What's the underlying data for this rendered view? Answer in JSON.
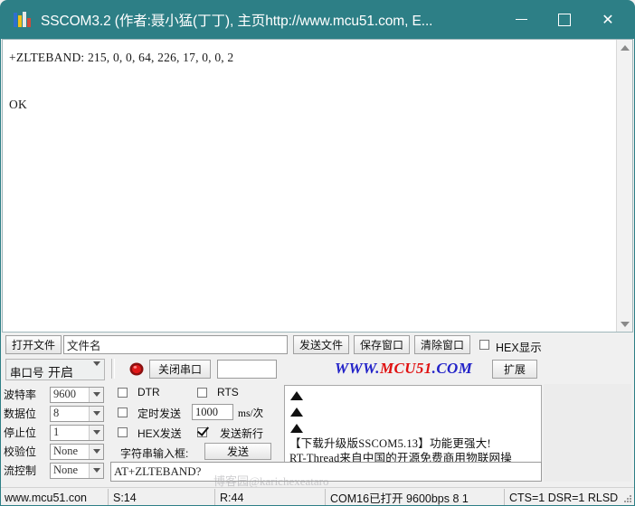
{
  "window": {
    "title": "SSCOM3.2 (作者:聂小猛(丁丁), 主页http://www.mcu51.com, E...",
    "icon": "sscom-app-icon",
    "minimize_label": "minimize-icon",
    "maximize_label": "maximize-icon",
    "close_label": "✕",
    "titlebar_color": "#2d7f86"
  },
  "receive": {
    "content": "+ZLTEBAND: 215, 0, 0, 64, 226, 17, 0, 0, 2\n\nOK",
    "scroll_up": "scroll-up-arrow",
    "scroll_down": "scroll-down-arrow"
  },
  "file_toolbar": {
    "open_file": "打开文件",
    "filename_value": "文件名",
    "send_file": "发送文件",
    "save_window": "保存窗口",
    "clear_window": "清除窗口",
    "hex_show_label": "HEX显示",
    "hex_show_checked": false
  },
  "port_toolbar": {
    "port_label": "串口号",
    "port_value": "开启",
    "led": "red-led-indicator",
    "close_port": "关闭串口",
    "extra_field_value": "",
    "brand_part1": "WWW.",
    "brand_part2": "MCU51",
    "brand_part3": ".COM",
    "brand_color1": "#2222c8",
    "brand_color2": "#e01010",
    "expand": "扩展"
  },
  "serial_params": [
    {
      "label": "波特率",
      "value": "9600"
    },
    {
      "label": "数据位",
      "value": "8"
    },
    {
      "label": "停止位",
      "value": "1"
    },
    {
      "label": "校验位",
      "value": "None"
    },
    {
      "label": "流控制",
      "value": "None"
    }
  ],
  "controls": {
    "dtr_label": "DTR",
    "dtr_checked": false,
    "rts_label": "RTS",
    "rts_checked": false,
    "timer_label": "定时发送",
    "timer_checked": false,
    "timer_value": "1000",
    "timer_unit": "ms/次",
    "hex_send_label": "HEX发送",
    "hex_send_checked": false,
    "newline_label": "发送新行",
    "newline_checked": true,
    "string_input_label": "字符串输入框:",
    "send_button": "发送"
  },
  "info_box": {
    "line1": "【下载升级版SSCOM5.13】功能更强大!",
    "line2": "RT-Thread来自中国的开源免费商用物联网操"
  },
  "send_input": {
    "value": "AT+ZLTEBAND?"
  },
  "watermark": {
    "text": "博客园@karichexeataro",
    "text2": "博客园@karichexeataro"
  },
  "statusbar": {
    "site": "www.mcu51.con",
    "sent": "S:14",
    "received": "R:44",
    "port_status": "COM16已打开 9600bps 8 1",
    "signals": "CTS=1 DSR=1 RLSD",
    "grip": "resize-grip-icon"
  }
}
